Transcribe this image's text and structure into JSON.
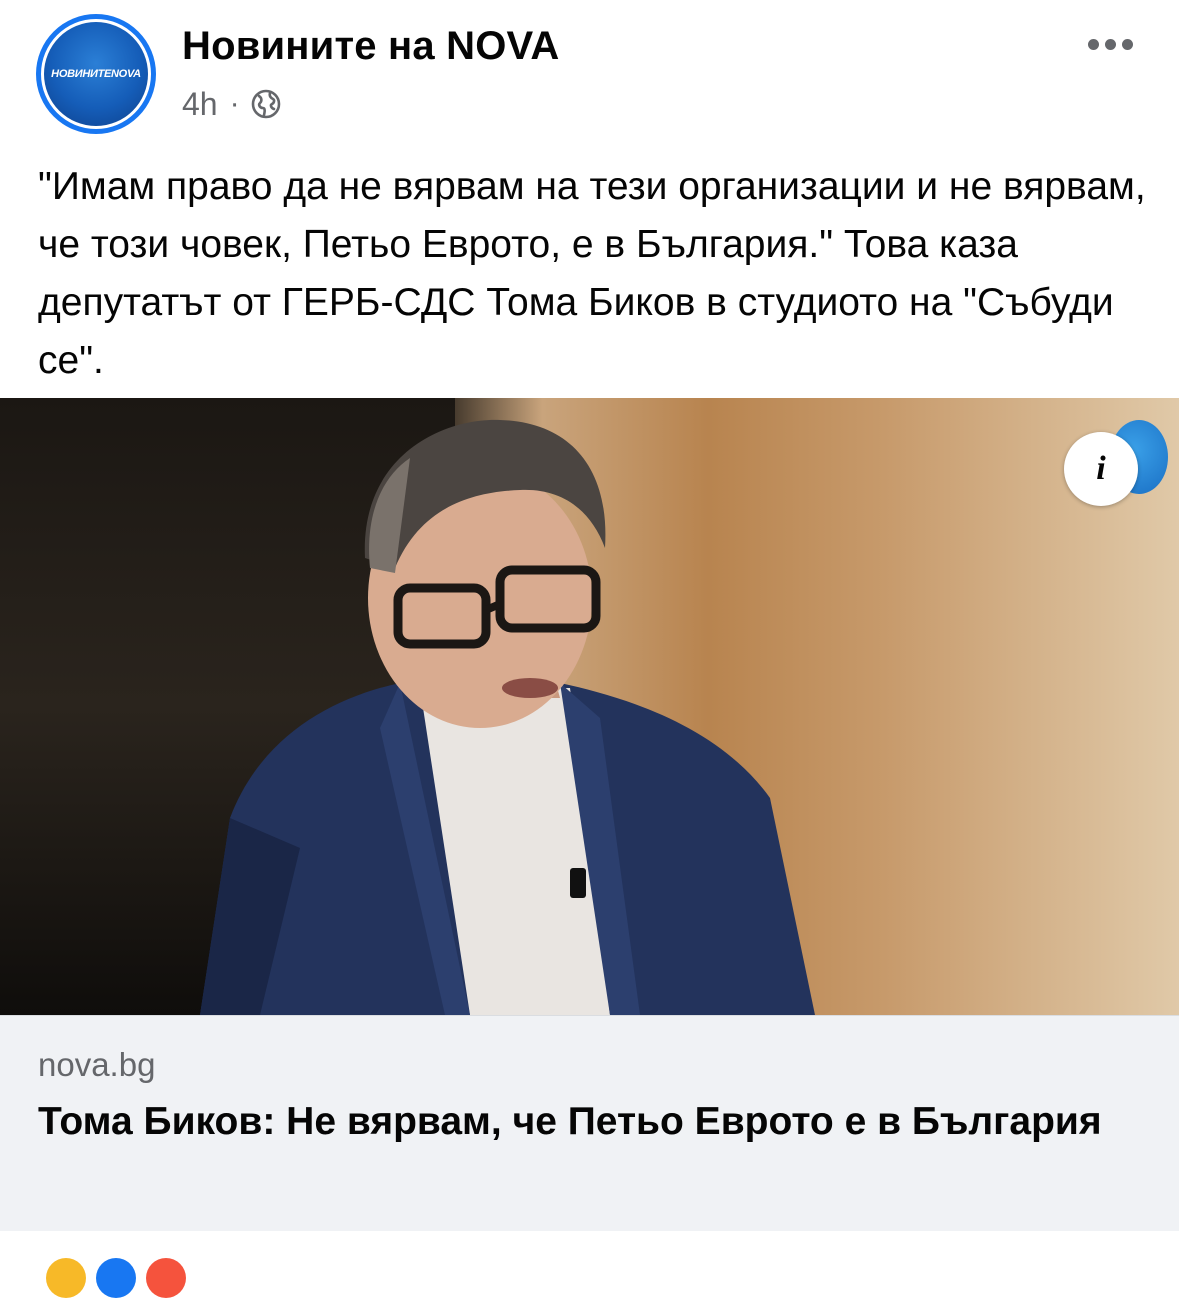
{
  "header": {
    "avatar_text": "НОВИНИТЕNOVA",
    "page_name": "Новините на NOVA",
    "time": "4h",
    "separator": "·",
    "privacy_icon": "globe-icon",
    "more_icon": "more-options-icon"
  },
  "post": {
    "text": "\"Имам право да не вярвам на тези организации и не вярвам, че този човек, Петьо Еврото, е в България.\" Това каза депутатът от ГЕРБ-СДС Тома Биков в студиото на \"Събуди се\"."
  },
  "link_preview": {
    "info_icon": "i",
    "domain": "nova.bg",
    "title": "Тома Биков: Не вярвам, че Петьо Еврото е в България"
  },
  "colors": {
    "accent": "#1877f2",
    "secondary_text": "#65676b",
    "link_bg": "#f0f2f5"
  }
}
